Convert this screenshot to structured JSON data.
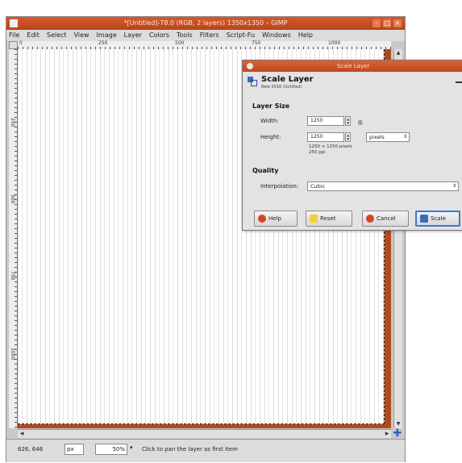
{
  "window": {
    "title": "*[Untitled]-78.0 (RGB, 2 layers) 1350x1350 – GIMP",
    "buttons": [
      "-",
      "□",
      "×"
    ]
  },
  "menu": [
    "File",
    "Edit",
    "Select",
    "View",
    "Image",
    "Layer",
    "Colors",
    "Tools",
    "Filters",
    "Script-Fu",
    "Windows",
    "Help"
  ],
  "ruler": {
    "top": [
      "0",
      "250",
      "500",
      "750",
      "1000"
    ],
    "left": [
      "250",
      "500",
      "750",
      "1000"
    ]
  },
  "status": {
    "coords": "626, 646",
    "unit": "px",
    "zoom": "50%",
    "message": "Click to pan the layer as first item"
  },
  "dialog": {
    "title": "Scale Layer",
    "heading": "Scale Layer",
    "subheading": "New 0316 (Untitled)",
    "layer_size_label": "Layer Size",
    "width_label": "Width:",
    "height_label": "Height:",
    "width_value": "1250",
    "height_value": "1250",
    "unit": "pixels",
    "size_info_1": "1250 × 1250 pixels",
    "size_info_2": "250 ppi",
    "quality_label": "Quality",
    "interpolation_label": "Interpolation:",
    "interpolation_value": "Cubic",
    "buttons": {
      "help": "Help",
      "reset": "Reset",
      "cancel": "Cancel",
      "scale": "Scale"
    }
  }
}
